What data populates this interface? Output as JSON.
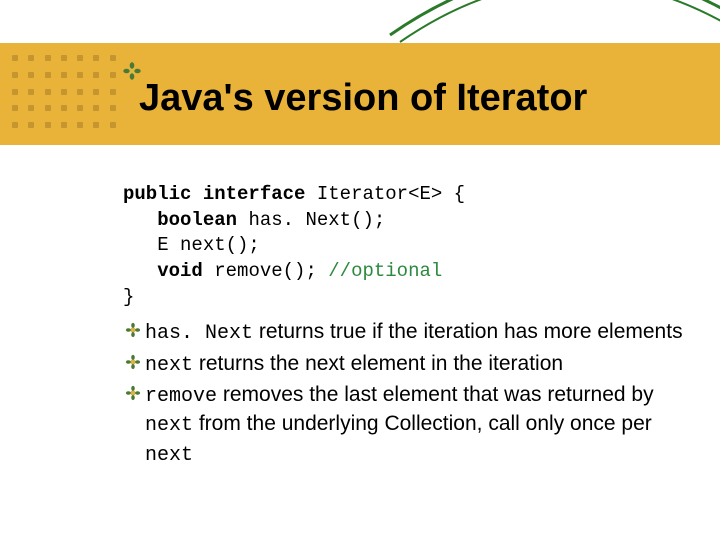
{
  "title": "Java's version of Iterator",
  "code": {
    "l1a": "public",
    "l1b": "interface",
    "l1c": "Iterator<E> {",
    "l2a": "boolean",
    "l2b": "has. Next();",
    "l3a": "E next();",
    "l4a": "void",
    "l4b": "remove();",
    "l4c": "//optional",
    "l5": "}"
  },
  "bullets": [
    {
      "mono1": "has. Next",
      "t1": " returns true if the iteration has more elements"
    },
    {
      "mono1": "next",
      "t1": " returns the next element in the iteration"
    },
    {
      "mono1": "remove",
      "t1": " removes the last element that was returned by ",
      "mono2": "next",
      "t2": " from the underlying Collection, call only once per ",
      "mono3": "next"
    }
  ]
}
